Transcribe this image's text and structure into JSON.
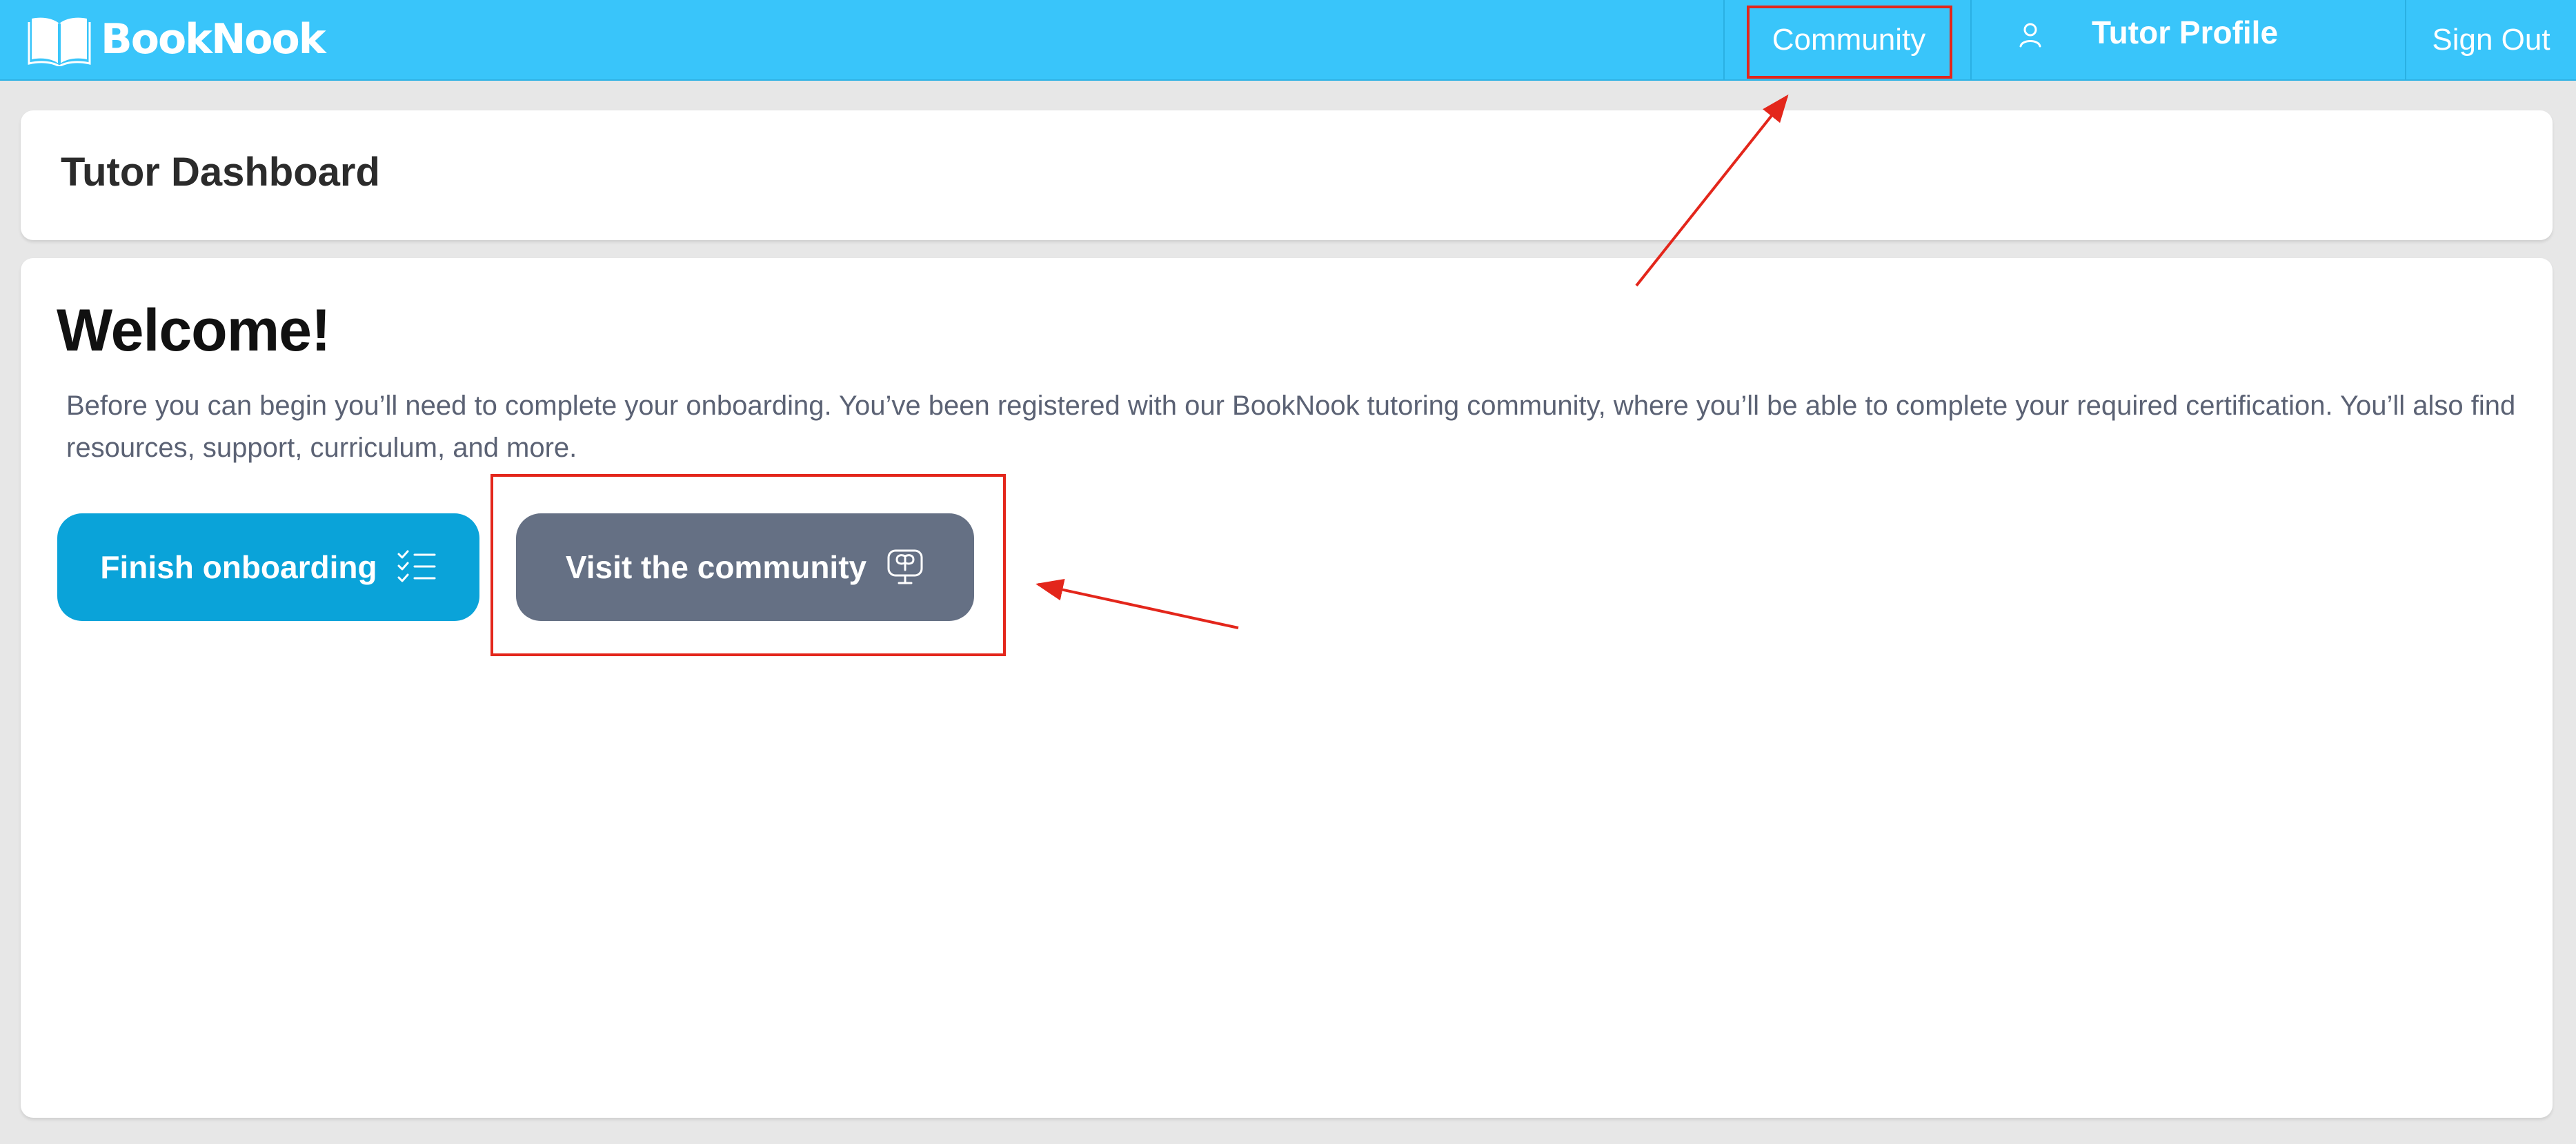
{
  "app": {
    "name": "BookNook",
    "logo_icon": "open-book-icon"
  },
  "nav": {
    "community_label": "Community",
    "profile_label": "Tutor Profile",
    "profile_icon": "user-icon",
    "signout_label": "Sign Out"
  },
  "header": {
    "title": "Tutor Dashboard"
  },
  "main": {
    "heading": "Welcome!",
    "intro": "Before you can begin you’ll need to complete your onboarding. You’ve been registered with our BookNook tutoring community, where you’ll be able to complete your required certification. You’ll also find resources, support, curriculum, and more.",
    "buttons": {
      "onboarding_label": "Finish onboarding",
      "onboarding_icon": "checklist-icon",
      "community_label": "Visit the community",
      "community_icon": "community-screen-icon"
    }
  },
  "colors": {
    "nav_background": "#39c5fa",
    "primary_button": "#0aa3d9",
    "secondary_button": "#657084",
    "annotation": "#e3261b",
    "page_background": "#e7e7e7"
  }
}
